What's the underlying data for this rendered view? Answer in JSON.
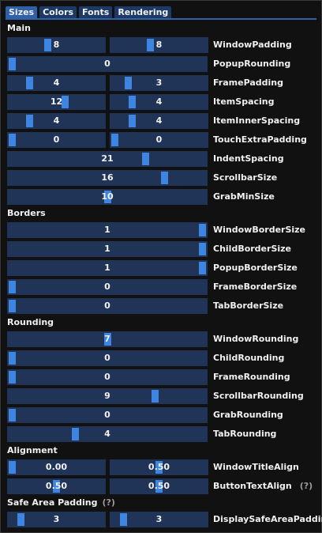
{
  "tabs": [
    {
      "label": "Sizes",
      "active": true
    },
    {
      "label": "Colors",
      "active": false
    },
    {
      "label": "Fonts",
      "active": false
    },
    {
      "label": "Rendering",
      "active": false
    }
  ],
  "sections": [
    {
      "title": "Main",
      "help": null,
      "rows": [
        {
          "label": "WindowPadding",
          "help": null,
          "sliders": [
            {
              "display": "8",
              "fraction": 0.4
            },
            {
              "display": "8",
              "fraction": 0.4
            }
          ]
        },
        {
          "label": "PopupRounding",
          "help": null,
          "sliders": [
            {
              "display": "0",
              "fraction": 0.0
            }
          ]
        },
        {
          "label": "FramePadding",
          "help": null,
          "sliders": [
            {
              "display": "4",
              "fraction": 0.2
            },
            {
              "display": "3",
              "fraction": 0.15
            }
          ]
        },
        {
          "label": "ItemSpacing",
          "help": null,
          "sliders": [
            {
              "display": "12",
              "fraction": 0.6
            },
            {
              "display": "4",
              "fraction": 0.2
            }
          ]
        },
        {
          "label": "ItemInnerSpacing",
          "help": null,
          "sliders": [
            {
              "display": "4",
              "fraction": 0.2
            },
            {
              "display": "4",
              "fraction": 0.2
            }
          ]
        },
        {
          "label": "TouchExtraPadding",
          "help": null,
          "sliders": [
            {
              "display": "0",
              "fraction": 0.0
            },
            {
              "display": "0",
              "fraction": 0.0
            }
          ]
        },
        {
          "label": "IndentSpacing",
          "help": null,
          "sliders": [
            {
              "display": "21",
              "fraction": 0.7
            }
          ]
        },
        {
          "label": "ScrollbarSize",
          "help": null,
          "sliders": [
            {
              "display": "16",
              "fraction": 0.8
            }
          ]
        },
        {
          "label": "GrabMinSize",
          "help": null,
          "sliders": [
            {
              "display": "10",
              "fraction": 0.5
            }
          ]
        }
      ]
    },
    {
      "title": "Borders",
      "help": null,
      "rows": [
        {
          "label": "WindowBorderSize",
          "help": null,
          "sliders": [
            {
              "display": "1",
              "fraction": 1.0
            }
          ]
        },
        {
          "label": "ChildBorderSize",
          "help": null,
          "sliders": [
            {
              "display": "1",
              "fraction": 1.0
            }
          ]
        },
        {
          "label": "PopupBorderSize",
          "help": null,
          "sliders": [
            {
              "display": "1",
              "fraction": 1.0
            }
          ]
        },
        {
          "label": "FrameBorderSize",
          "help": null,
          "sliders": [
            {
              "display": "0",
              "fraction": 0.0
            }
          ]
        },
        {
          "label": "TabBorderSize",
          "help": null,
          "sliders": [
            {
              "display": "0",
              "fraction": 0.0
            }
          ]
        }
      ]
    },
    {
      "title": "Rounding",
      "help": null,
      "rows": [
        {
          "label": "WindowRounding",
          "help": null,
          "sliders": [
            {
              "display": "7",
              "fraction": 0.5
            }
          ]
        },
        {
          "label": "ChildRounding",
          "help": null,
          "sliders": [
            {
              "display": "0",
              "fraction": 0.0
            }
          ]
        },
        {
          "label": "FrameRounding",
          "help": null,
          "sliders": [
            {
              "display": "0",
              "fraction": 0.0
            }
          ]
        },
        {
          "label": "ScrollbarRounding",
          "help": null,
          "sliders": [
            {
              "display": "9",
              "fraction": 0.75
            }
          ]
        },
        {
          "label": "GrabRounding",
          "help": null,
          "sliders": [
            {
              "display": "0",
              "fraction": 0.0
            }
          ]
        },
        {
          "label": "TabRounding",
          "help": null,
          "sliders": [
            {
              "display": "4",
              "fraction": 0.33
            }
          ]
        }
      ]
    },
    {
      "title": "Alignment",
      "help": null,
      "rows": [
        {
          "label": "WindowTitleAlign",
          "help": null,
          "sliders": [
            {
              "display": "0.00",
              "fraction": 0.0
            },
            {
              "display": "0.50",
              "fraction": 0.5
            }
          ]
        },
        {
          "label": "ButtonTextAlign",
          "help": "(?)",
          "sliders": [
            {
              "display": "0.50",
              "fraction": 0.5
            },
            {
              "display": "0.50",
              "fraction": 0.5
            }
          ]
        }
      ]
    },
    {
      "title": "Safe Area Padding",
      "help": "(?)",
      "rows": [
        {
          "label": "DisplaySafeAreaPadding",
          "help": null,
          "sliders": [
            {
              "display": "3",
              "fraction": 0.1
            },
            {
              "display": "3",
              "fraction": 0.1
            }
          ]
        }
      ]
    }
  ]
}
